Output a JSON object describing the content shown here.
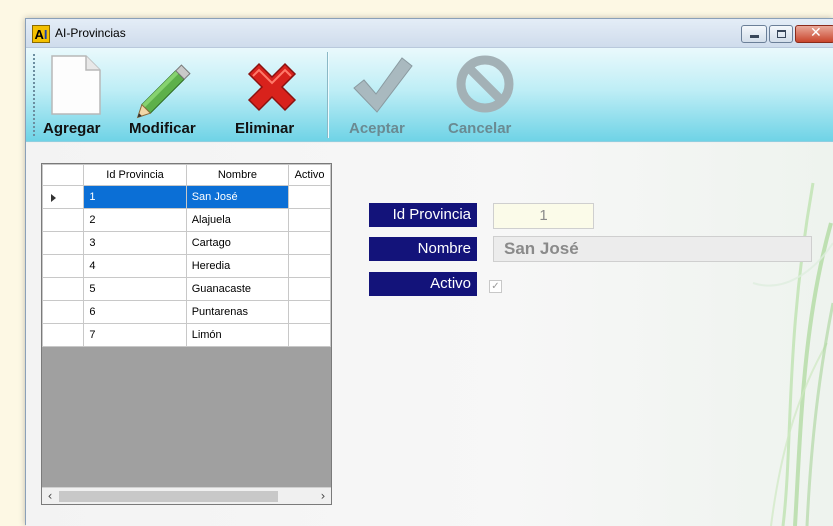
{
  "window": {
    "title": "AI-Provincias",
    "icon_letters": "A",
    "icon_letters2": "I"
  },
  "toolbar": {
    "agregar": "Agregar",
    "modificar": "Modificar",
    "eliminar": "Eliminar",
    "aceptar": "Aceptar",
    "cancelar": "Cancelar"
  },
  "grid": {
    "columns": [
      "Id Provincia",
      "Nombre",
      "Activo"
    ],
    "rows": [
      {
        "id": "1",
        "nombre": "San José",
        "selected": true
      },
      {
        "id": "2",
        "nombre": "Alajuela"
      },
      {
        "id": "3",
        "nombre": "Cartago"
      },
      {
        "id": "4",
        "nombre": "Heredia"
      },
      {
        "id": "5",
        "nombre": "Guanacaste"
      },
      {
        "id": "6",
        "nombre": "Puntarenas"
      },
      {
        "id": "7",
        "nombre": "Limón"
      }
    ]
  },
  "form": {
    "id_label": "Id Provincia",
    "id_value": "1",
    "nombre_label": "Nombre",
    "nombre_value": "San José",
    "activo_label": "Activo",
    "activo_checked": true
  },
  "colors": {
    "label_bg": "#13137a",
    "selection": "#0b6fd6",
    "toolbar_accent": "#6fd3e6"
  }
}
